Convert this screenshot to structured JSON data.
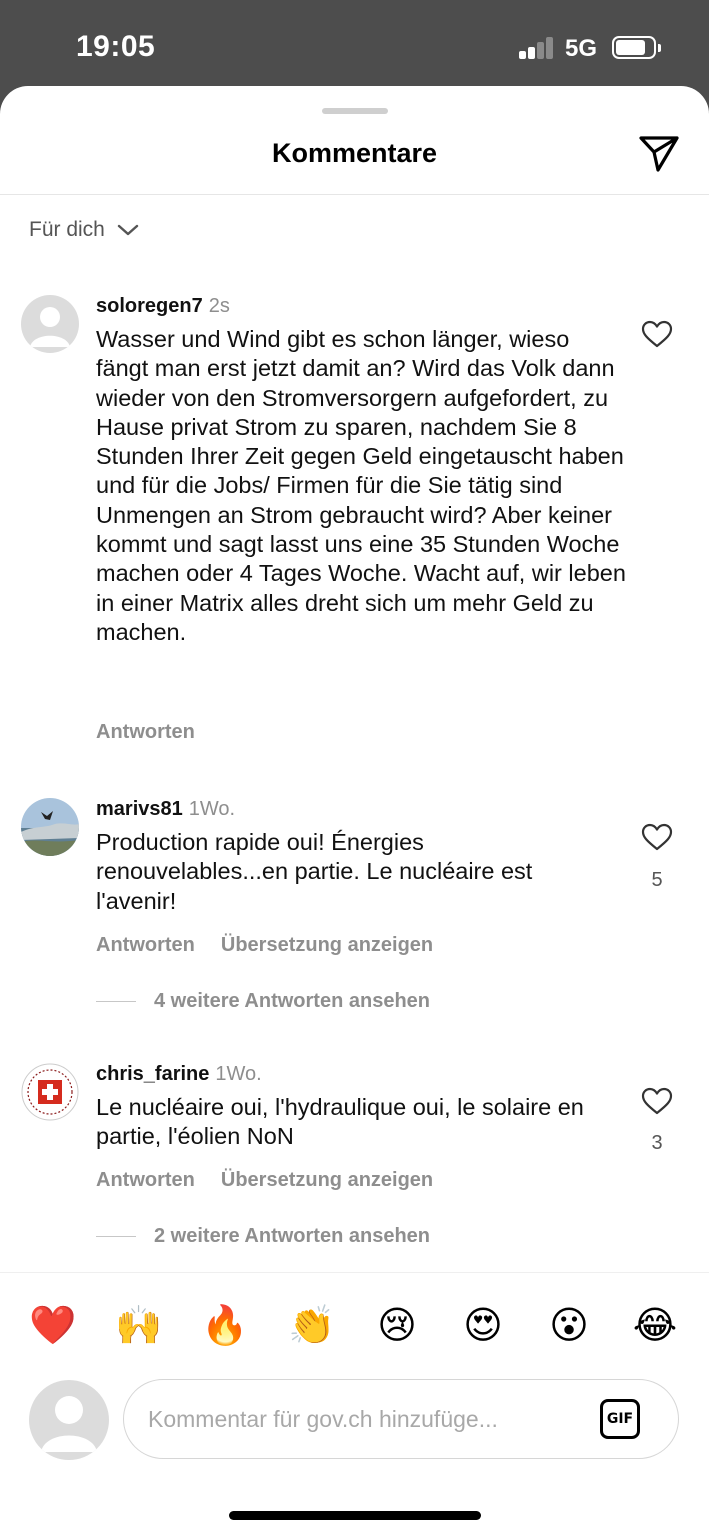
{
  "status_bar": {
    "time": "19:05",
    "network": "5G"
  },
  "header": {
    "title": "Kommentare",
    "share_icon": "paper-plane-icon"
  },
  "filter": {
    "label": "Für dich",
    "icon": "chevron-down-icon"
  },
  "comments": [
    {
      "username": "soloregen7",
      "time": "2s",
      "text": "Wasser und Wind gibt es schon länger, wieso fängt man erst jetzt damit an? Wird das Volk dann wieder von den Stromversorgern aufgefordert, zu Hause privat Strom zu sparen, nachdem Sie 8 Stunden Ihrer Zeit gegen Geld eingetauscht haben und für die Jobs/ Firmen für die Sie tätig sind Unmengen an Strom gebraucht wird? Aber keiner kommt und sagt lasst uns eine 35 Stunden Woche machen oder 4 Tages Woche. Wacht auf, wir leben in einer Matrix alles dreht sich um mehr Geld zu machen.",
      "reply": "Antworten"
    },
    {
      "username": "marivs81",
      "time": "1Wo.",
      "text": "Production rapide oui! Énergies renouvelables...en partie. Le nucléaire est l'avenir!",
      "reply": "Antworten",
      "translate": "Übersetzung anzeigen",
      "likes": "5",
      "more_replies": "4 weitere Antworten ansehen"
    },
    {
      "username": "chris_farine",
      "time": "1Wo.",
      "text": "Le nucléaire oui, l'hydraulique oui, le solaire en partie, l'éolien NoN",
      "reply": "Antworten",
      "translate": "Übersetzung anzeigen",
      "likes": "3",
      "more_replies": "2 weitere Antworten ansehen"
    }
  ],
  "emoji_bar": [
    "❤️",
    "🙌",
    "🔥",
    "👏",
    "😢",
    "😍",
    "😮",
    "😂"
  ],
  "composer": {
    "placeholder": "Kommentar für gov.ch hinzufüge...",
    "gif_label": "GIF"
  }
}
